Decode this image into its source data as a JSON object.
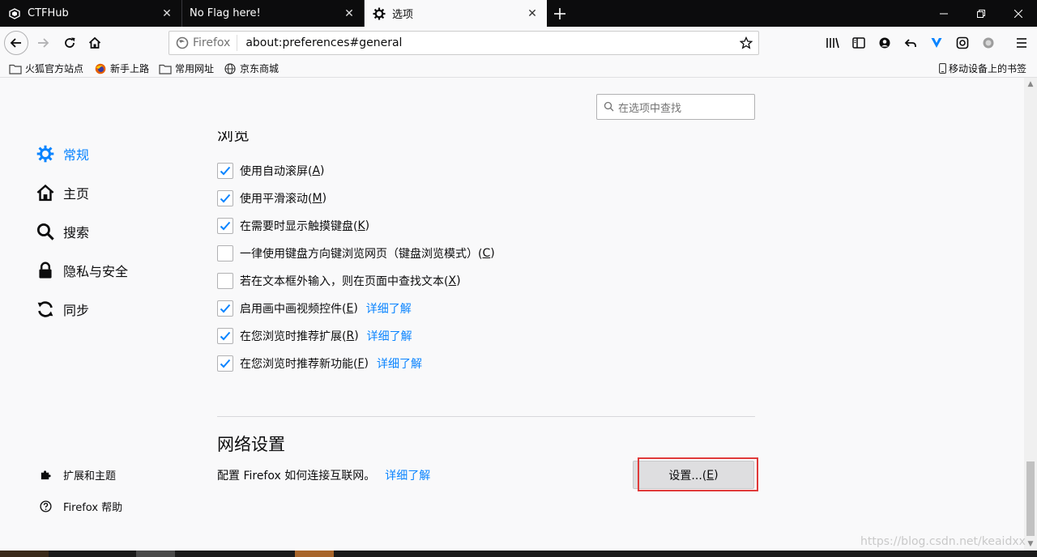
{
  "tabs": [
    {
      "title": "CTFHub",
      "favicon": "ctfhub-icon",
      "active": false
    },
    {
      "title": "No Flag here!",
      "favicon": "",
      "active": false
    },
    {
      "title": "选项",
      "favicon": "gear-icon",
      "active": true
    }
  ],
  "urlbar": {
    "identity_label": "Firefox",
    "url": "about:preferences#general"
  },
  "bookmarks": [
    {
      "label": "火狐官方站点",
      "icon": "folder-icon"
    },
    {
      "label": "新手上路",
      "icon": "firefox-icon"
    },
    {
      "label": "常用网址",
      "icon": "folder-icon"
    },
    {
      "label": "京东商城",
      "icon": "globe-icon"
    }
  ],
  "mobile_bookmarks": "移动设备上的书签",
  "search": {
    "placeholder": "在选项中查找"
  },
  "categories": [
    {
      "label": "常规",
      "icon": "gear-icon",
      "selected": true
    },
    {
      "label": "主页",
      "icon": "home-icon",
      "selected": false
    },
    {
      "label": "搜索",
      "icon": "search-icon",
      "selected": false
    },
    {
      "label": "隐私与安全",
      "icon": "lock-icon",
      "selected": false
    },
    {
      "label": "同步",
      "icon": "sync-icon",
      "selected": false
    }
  ],
  "footer_nav": [
    {
      "label": "扩展和主题",
      "icon": "puzzle-icon"
    },
    {
      "label": "Firefox 帮助",
      "icon": "help-icon"
    }
  ],
  "browsing": {
    "heading": "浏览",
    "options": [
      {
        "text": "使用自动滚屏(",
        "key": "A",
        "tail": ")",
        "checked": true,
        "link": ""
      },
      {
        "text": "使用平滑滚动(",
        "key": "M",
        "tail": ")",
        "checked": true,
        "link": ""
      },
      {
        "text": "在需要时显示触摸键盘(",
        "key": "K",
        "tail": ")",
        "checked": true,
        "link": ""
      },
      {
        "text": "一律使用键盘方向键浏览网页（键盘浏览模式）(",
        "key": "C",
        "tail": ")",
        "checked": false,
        "link": ""
      },
      {
        "text": "若在文本框外输入，则在页面中查找文本(",
        "key": "X",
        "tail": ")",
        "checked": false,
        "link": ""
      },
      {
        "text": "启用画中画视频控件(",
        "key": "E",
        "tail": ")",
        "checked": true,
        "link": "详细了解"
      },
      {
        "text": "在您浏览时推荐扩展(",
        "key": "R",
        "tail": ")",
        "checked": true,
        "link": "详细了解"
      },
      {
        "text": "在您浏览时推荐新功能(",
        "key": "F",
        "tail": ")",
        "checked": true,
        "link": "详细了解"
      }
    ]
  },
  "network": {
    "title": "网络设置",
    "description": "配置 Firefox 如何连接互联网。",
    "link": "详细了解",
    "button_text": "设置...(",
    "button_key": "E",
    "button_tail": ")"
  },
  "watermark": "https://blog.csdn.net/keaidxx",
  "colors": {
    "accent": "#0a84ff",
    "highlight": "#e03a3a",
    "tabstrip": "#0c0c0d"
  }
}
